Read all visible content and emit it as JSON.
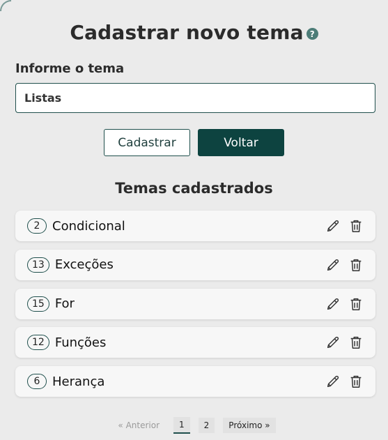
{
  "header": {
    "title": "Cadastrar novo tema",
    "help_glyph": "?"
  },
  "form": {
    "label": "Informe o tema",
    "input_value": "Listas",
    "submit_label": "Cadastrar",
    "back_label": "Voltar"
  },
  "list": {
    "title": "Temas cadastrados",
    "items": [
      {
        "count": "2",
        "name": "Condicional"
      },
      {
        "count": "13",
        "name": "Exceções"
      },
      {
        "count": "15",
        "name": "For"
      },
      {
        "count": "12",
        "name": "Funções"
      },
      {
        "count": "6",
        "name": "Herança"
      }
    ],
    "item_icons": [
      "pencil-icon",
      "trash-icon"
    ]
  },
  "pagination": {
    "prev_label": "« Anterior",
    "pages": [
      "1",
      "2"
    ],
    "current_page": "1",
    "next_label": "Próximo »"
  },
  "colors": {
    "accent": "#0d4340",
    "background": "#ebebeb",
    "card": "#f7f7f7"
  }
}
